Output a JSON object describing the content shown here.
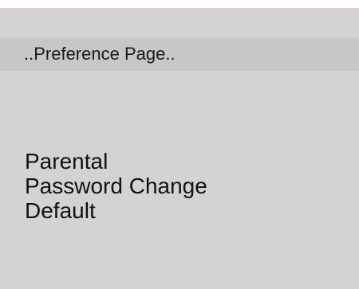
{
  "page": {
    "title": "..Preference Page..",
    "background_color": "#d4d2d2",
    "title_bar_color": "#c8c6c6",
    "text_color": "#111111"
  },
  "menu": {
    "items": [
      {
        "label": "Parental"
      },
      {
        "label": "Password Change"
      },
      {
        "label": "Default"
      }
    ]
  }
}
